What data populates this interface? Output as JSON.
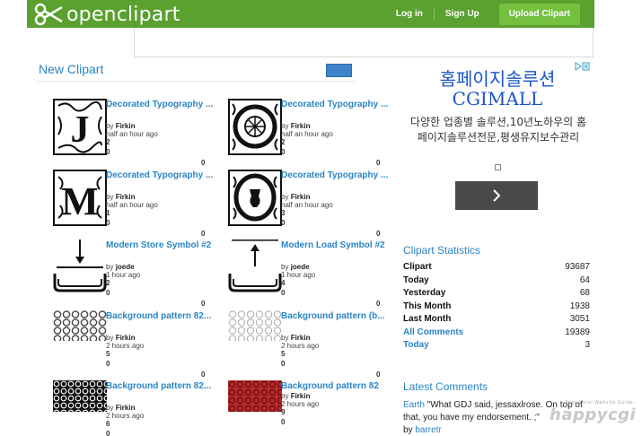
{
  "header": {
    "logo_text": "openclipart",
    "nav": {
      "login": "Log in",
      "signup": "Sign Up",
      "upload": "Upload Clipart"
    },
    "brand_color": "#5aa12f"
  },
  "new_clipart": {
    "title": "New Clipart",
    "items": [
      {
        "title": "Decorated Typography ...",
        "by_label": "by",
        "author": "Firkin",
        "time": "half an hour ago",
        "n1": "2",
        "n2": "0",
        "right": "0"
      },
      {
        "title": "Decorated Typography ...",
        "by_label": "by",
        "author": "Firkin",
        "time": "half an hour ago",
        "n1": "2",
        "n2": "0",
        "right": "0"
      },
      {
        "title": "Decorated Typography ...",
        "by_label": "by",
        "author": "Firkin",
        "time": "half an hour ago",
        "n1": "1",
        "n2": "0",
        "right": "0"
      },
      {
        "title": "Decorated Typography ...",
        "by_label": "by",
        "author": "Firkin",
        "time": "half an hour ago",
        "n1": "3",
        "n2": "0",
        "right": "0"
      },
      {
        "title": "Modern Store Symbol #2",
        "by_label": "by",
        "author": "joede",
        "time": "1 hour ago",
        "n1": "2",
        "n2": "0",
        "right": "0"
      },
      {
        "title": "Modern Load Symbol #2",
        "by_label": "by",
        "author": "joede",
        "time": "1 hour ago",
        "n1": "4",
        "n2": "0",
        "right": "0"
      },
      {
        "title": "Background pattern 82...",
        "by_label": "by",
        "author": "Firkin",
        "time": "2 hours ago",
        "n1": "5",
        "n2": "0",
        "right": "0"
      },
      {
        "title": "Background pattern (b...",
        "by_label": "by",
        "author": "Firkin",
        "time": "2 hours ago",
        "n1": "5",
        "n2": "0",
        "right": "0"
      },
      {
        "title": "Background pattern 82...",
        "by_label": "by",
        "author": "Firkin",
        "time": "2 hours ago",
        "n1": "6",
        "n2": "0",
        "right": "0"
      },
      {
        "title": "Background pattern 82",
        "by_label": "by",
        "author": "Firkin",
        "time": "2 hours ago",
        "n1": "9",
        "n2": "0",
        "right": "0"
      }
    ]
  },
  "ad": {
    "headline": "홈페이지솔루션",
    "brand": "CGIMALL",
    "description": "다양한 업종별 솔루션,10년노하우의 홈페이지솔루션전문,평생유지보수관리",
    "next_icon": "chevron-right-icon"
  },
  "stats": {
    "title": "Clipart Statistics",
    "rows": [
      {
        "label": "Clipart",
        "value": "93687"
      },
      {
        "label": "Today",
        "value": "64"
      },
      {
        "label": "Yesterday",
        "value": "68"
      },
      {
        "label": "This Month",
        "value": "1938"
      },
      {
        "label": "Last Month",
        "value": "3051"
      },
      {
        "label": "All Comments",
        "value": "19389"
      },
      {
        "label": "Today",
        "value": "3"
      }
    ]
  },
  "latest_comments": {
    "title": "Latest Comments",
    "subject": "Earth",
    "text": " \"What GDJ said, jessaxlrose. On top of that, you have my endorsement. ;\"",
    "by_label": "by ",
    "author": "barretr"
  },
  "watermark": {
    "text": "happycgi",
    "small": "Your Local Website Guide"
  }
}
